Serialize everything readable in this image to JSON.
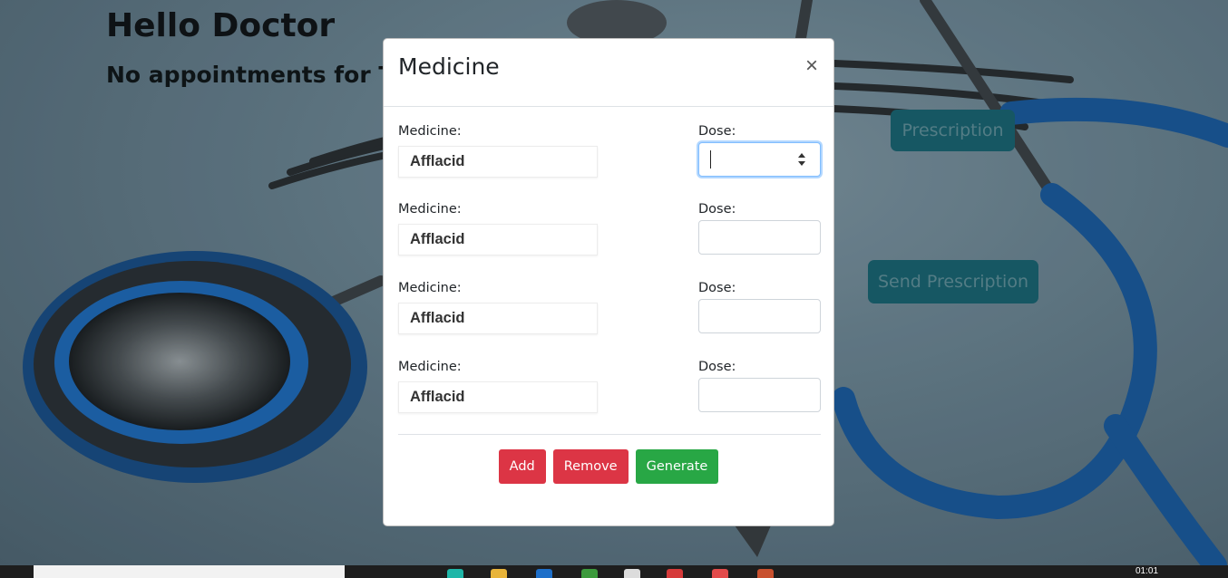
{
  "page": {
    "greeting": "Hello Doctor",
    "subtitle": "No appointments for To",
    "prescription_button": "Prescription",
    "send_prescription_button": "Send Prescription"
  },
  "modal": {
    "title": "Medicine",
    "close_label": "×",
    "rows": [
      {
        "medicine_label": "Medicine:",
        "medicine_value": "Afflacid",
        "dose_label": "Dose:",
        "dose_value": ""
      },
      {
        "medicine_label": "Medicine:",
        "medicine_value": "Afflacid",
        "dose_label": "Dose:",
        "dose_value": ""
      },
      {
        "medicine_label": "Medicine:",
        "medicine_value": "Afflacid",
        "dose_label": "Dose:",
        "dose_value": ""
      },
      {
        "medicine_label": "Medicine:",
        "medicine_value": "Afflacid",
        "dose_label": "Dose:",
        "dose_value": ""
      }
    ],
    "actions": {
      "add": "Add",
      "remove": "Remove",
      "generate": "Generate"
    }
  },
  "taskbar": {
    "clock": "01:01"
  },
  "colors": {
    "danger": "#dc3545",
    "success": "#28a745",
    "background_button": "#1a6471"
  }
}
